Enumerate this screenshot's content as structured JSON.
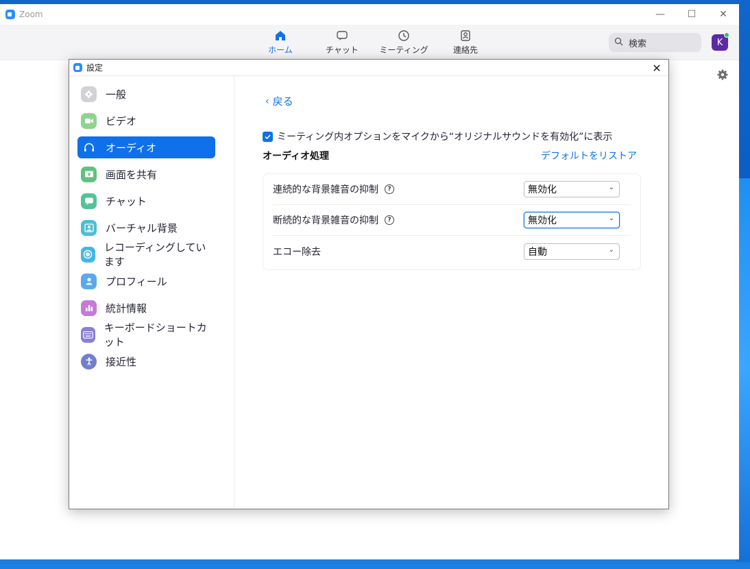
{
  "window": {
    "title": "Zoom"
  },
  "window_controls": {
    "minimize": "—",
    "maximize": "☐",
    "close": "✕"
  },
  "nav": {
    "tabs": [
      {
        "label": "ホーム",
        "icon": "home-icon",
        "active": true
      },
      {
        "label": "チャット",
        "icon": "chat-icon",
        "active": false
      },
      {
        "label": "ミーティング",
        "icon": "clock-icon",
        "active": false
      },
      {
        "label": "連絡先",
        "icon": "contacts-icon",
        "active": false
      }
    ]
  },
  "search": {
    "placeholder": "検索"
  },
  "profile": {
    "initial": "K",
    "status_color": "#2dc26b"
  },
  "settings": {
    "title": "設定",
    "close": "✕",
    "sidebar": [
      {
        "label": "一般",
        "icon": "gear-icon",
        "color": "#c5c5c9"
      },
      {
        "label": "ビデオ",
        "icon": "video-icon",
        "color": "#7bd07a"
      },
      {
        "label": "オーディオ",
        "icon": "headphones-icon",
        "color": "#0e71eb",
        "active": true
      },
      {
        "label": "画面を共有",
        "icon": "share-screen-icon",
        "color": "#5fc27d"
      },
      {
        "label": "チャット",
        "icon": "chat-icon",
        "color": "#54c39a"
      },
      {
        "label": "バーチャル背景",
        "icon": "virtual-background-icon",
        "color": "#4bbfd1"
      },
      {
        "label": "レコーディングしています",
        "icon": "record-icon",
        "color": "#43b8e6"
      },
      {
        "label": "プロフィール",
        "icon": "profile-icon",
        "color": "#4aa2ee"
      },
      {
        "label": "統計情報",
        "icon": "statistics-icon",
        "color": "#c47ad6"
      },
      {
        "label": "キーボードショートカット",
        "icon": "keyboard-icon",
        "color": "#8a7fd6"
      },
      {
        "label": "接近性",
        "icon": "accessibility-icon",
        "color": "#6f80cc"
      }
    ],
    "content": {
      "back_label": "戻る",
      "checkbox_label": "ミーティング内オプションをマイクから“オリジナルサウンドを有効化”に表示",
      "checkbox_checked": true,
      "section_title": "オーディオ処理",
      "restore_label": "デフォルトをリストア",
      "rows": [
        {
          "label": "連続的な背景雑音の抑制",
          "help": "?",
          "value": "無効化"
        },
        {
          "label": "断続的な背景雑音の抑制",
          "help": "?",
          "value": "無効化"
        },
        {
          "label": "エコー除去",
          "value": "自動"
        }
      ]
    }
  },
  "colors": {
    "accent": "#0e71eb",
    "toolbar_bg": "#f4f4f6"
  }
}
